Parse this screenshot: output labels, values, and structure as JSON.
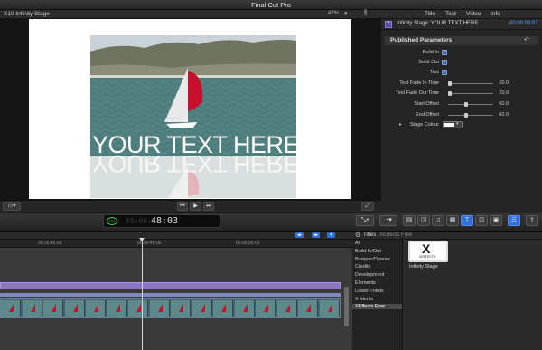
{
  "app": {
    "title": "Final Cut Pro"
  },
  "viewer": {
    "clip_name": "X10 Infinity Stage",
    "zoom": "42%",
    "zoom_menu": "▾",
    "zoom_toggle": "⫼",
    "overlay_text": "YOUR TEXT HERE"
  },
  "inspector": {
    "tabs": [
      "Title",
      "Text",
      "Video",
      "Info"
    ],
    "clip_title": "Infinity Stage: YOUR TEXT HERE",
    "duration": "00:00:09:07",
    "section_title": "Published Parameters",
    "reset_icon": "↶",
    "checkbox_params": [
      {
        "label": "Build In",
        "checked": true
      },
      {
        "label": "Build Out",
        "checked": true
      },
      {
        "label": "Text",
        "checked": true
      }
    ],
    "slider_params": [
      {
        "label": "Text Fade In Time",
        "value": "20.0",
        "fraction": 0.0
      },
      {
        "label": "Text Fade Out Time",
        "value": "20.0",
        "fraction": 0.0
      },
      {
        "label": "Start Offset",
        "value": "60.0",
        "fraction": 0.4
      },
      {
        "label": "End Offset",
        "value": "60.0",
        "fraction": 0.4
      }
    ],
    "color_param": {
      "label": "Stage Colour",
      "color": "#ffffff",
      "disclosure": "▸",
      "menu": "▾"
    }
  },
  "toolbar": {
    "timecode": "48:03",
    "timecode_dim": "00:00:",
    "indicator": "100"
  },
  "timeline": {
    "ruler_labels": [
      "00:00:46:00",
      "00:00:48:00",
      "00:00:50:00"
    ]
  },
  "browser": {
    "head_title": "Titles",
    "head_sub": "XEffects Free",
    "categories": [
      "All",
      "Build In/Out",
      "Bumper/Opener",
      "Credits",
      "Development",
      "Elements",
      "Lower Thirds",
      "X Idents",
      "XEffects Free"
    ],
    "selected_category": "XEffects Free",
    "items": [
      {
        "name": "Infinity Stage",
        "logo": "X",
        "logo_sub": "XEFFECTS"
      }
    ]
  }
}
